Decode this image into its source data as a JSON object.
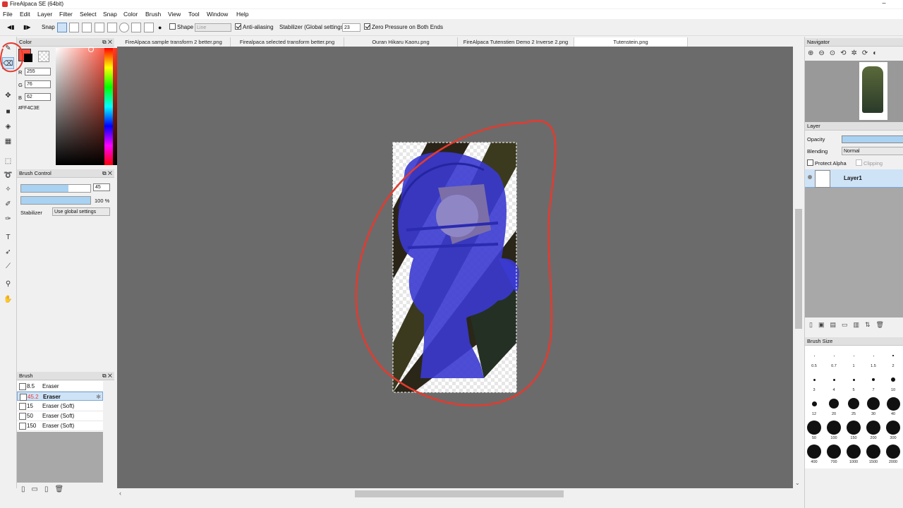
{
  "app": {
    "title": "FireAlpaca SE (64bit)",
    "minimize": "–"
  },
  "menu": [
    "File",
    "Edit",
    "Layer",
    "Filter",
    "Select",
    "Snap",
    "Color",
    "Brush",
    "View",
    "Tool",
    "Window",
    "Help"
  ],
  "toolbar": {
    "snap_label": "Snap",
    "shape_label": "Shape",
    "shape_value": "Line",
    "antialias_label": "Anti-aliasing",
    "stabilizer_label": "Stabilizer (Global settings)",
    "stabilizer_value": "23",
    "zero_pressure_label": "Zero Pressure on Both Ends"
  },
  "color_panel": {
    "title": "Color",
    "r_label": "R",
    "r": "255",
    "g_label": "G",
    "g": "76",
    "b_label": "B",
    "b": "62",
    "hex": "#FF4C3E",
    "primary_color": "#FF4C3E"
  },
  "brush_control": {
    "title": "Brush Control",
    "size": "45",
    "size_fill": 0.68,
    "opacity": "100 %",
    "opacity_fill": 1.0,
    "stabilizer_label": "Stabilizer",
    "stabilizer_value": "Use global settings"
  },
  "brush_panel": {
    "title": "Brush",
    "items": [
      {
        "size": "8.5",
        "name": "Eraser"
      },
      {
        "size": "45.2",
        "name": "Eraser"
      },
      {
        "size": "15",
        "name": "Eraser (Soft)"
      },
      {
        "size": "50",
        "name": "Eraser (Soft)"
      },
      {
        "size": "150",
        "name": "Eraser (Soft)"
      }
    ]
  },
  "tabs": [
    {
      "label": "FireAlpaca sample transform 2 better.png"
    },
    {
      "label": "Firealpaca selected transform better.png"
    },
    {
      "label": "Ouran Hikaru Kaoru.png"
    },
    {
      "label": "FireAlpaca Tutenstien Demo 2 Inverse 2.png"
    },
    {
      "label": "Tutenstein.png"
    }
  ],
  "navigator": {
    "title": "Navigator"
  },
  "layer_panel": {
    "title": "Layer",
    "opacity_label": "Opacity",
    "blending_label": "Blending",
    "blending_value": "Normal",
    "protect_alpha_label": "Protect Alpha",
    "clipping_label": "Clipping",
    "layer_name": "Layer1"
  },
  "brush_size_panel": {
    "title": "Brush Size",
    "sizes": [
      "0.5",
      "0.7",
      "1",
      "1.5",
      "2",
      "3",
      "4",
      "5",
      "7",
      "10",
      "12",
      "20",
      "25",
      "30",
      "40",
      "50",
      "100",
      "150",
      "200",
      "300",
      "400",
      "700",
      "1000",
      "1500",
      "2000"
    ]
  },
  "colors": {
    "accent": "#FF4C3E",
    "selection": "#cfe3f7",
    "canvas_bg": "#6b6b6b",
    "figure": "#3a3ad0"
  }
}
